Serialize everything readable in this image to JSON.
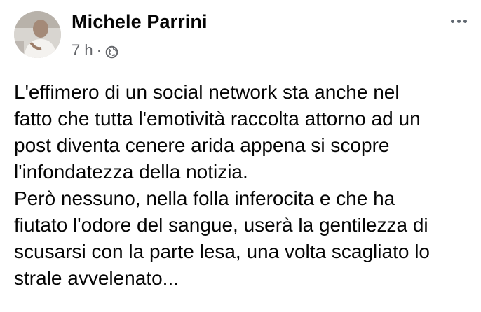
{
  "post": {
    "author_name": "Michele Parrini",
    "time": "7 h",
    "separator": "·",
    "audience_icon": "globe-icon",
    "more_icon": "more-options-icon",
    "text_lines": [
      "L'effimero di un social network sta anche nel",
      "fatto che tutta l'emotività raccolta attorno ad un",
      "post diventa cenere arida appena si scopre",
      "l'infondatezza della notizia.",
      "Però nessuno, nella folla inferocita e che ha",
      "fiutato l'odore del sangue, userà la gentilezza di",
      "scusarsi con la parte lesa, una volta scagliato lo",
      "strale avvelenato..."
    ]
  },
  "colors": {
    "text_primary": "#050505",
    "text_secondary": "#65676b",
    "background": "#ffffff"
  }
}
